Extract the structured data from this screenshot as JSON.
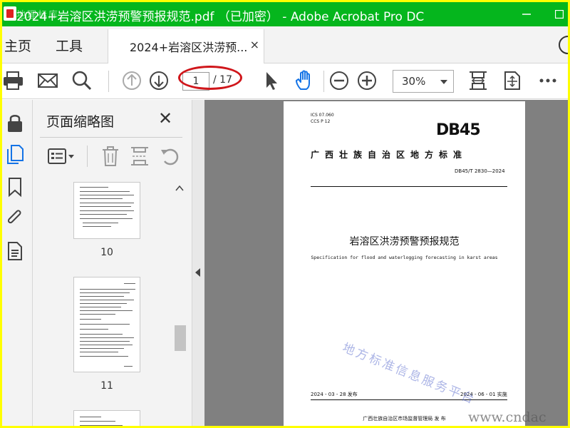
{
  "window": {
    "title": "2024+岩溶区洪涝预警预报规范.pdf （已加密） - Adobe Acrobat Pro DC",
    "watermark": "地理标库"
  },
  "menu": {
    "home": "主页",
    "tools": "工具",
    "tab_label": "2024+岩溶区洪涝预...",
    "tab_close": "×"
  },
  "toolbar": {
    "page_current": "1",
    "page_total": "/ 17",
    "zoom": "30%"
  },
  "thumbnail_panel": {
    "title": "页面缩略图",
    "close": "✕",
    "thumbnails": [
      {
        "label": "10"
      },
      {
        "label": "11"
      }
    ]
  },
  "document": {
    "ics": "ICS  07.060",
    "ccs": "CCS  P 12",
    "db_logo": "DB45",
    "standard_name": "广西壮族自治区地方标准",
    "standard_code": "DB45/T 2830—2024",
    "title": "岩溶区洪涝预警预报规范",
    "subtitle": "Specification for flood and waterlogging forecasting in karst areas",
    "release_date": "2024 - 03 - 28 发布",
    "implement_date": "2024 - 06 - 01 实施",
    "publisher": "广西壮族自治区市场监督管理局    发 布",
    "watermark": "地方标准信息服务平台",
    "site_watermark": "www.cndac"
  },
  "colors": {
    "titlebar": "#05B61D",
    "frame_border": "#FFFF00",
    "annotation": "#D0161B",
    "hand_tool": "#1473E6"
  }
}
